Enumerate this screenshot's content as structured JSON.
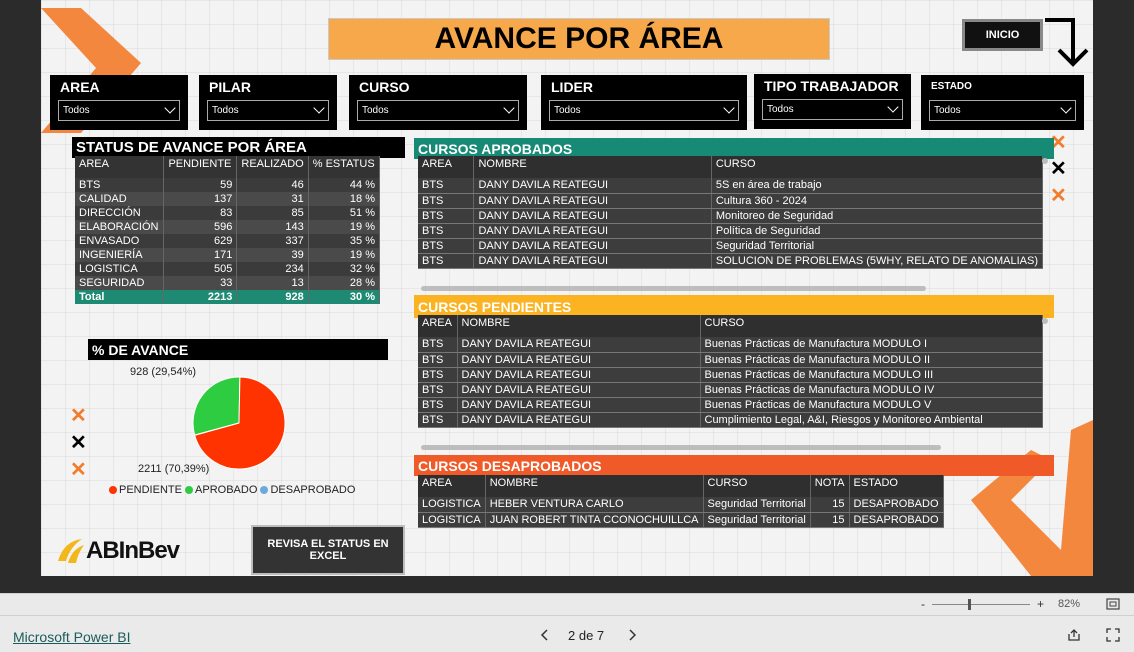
{
  "title": "AVANCE POR ÁREA",
  "inicio_button": "INICIO",
  "slicers": [
    {
      "label": "AREA",
      "value": "Todos"
    },
    {
      "label": "PILAR",
      "value": "Todos"
    },
    {
      "label": "CURSO",
      "value": "Todos"
    },
    {
      "label": "LIDER",
      "value": "Todos"
    },
    {
      "label": "TIPO TRABAJADOR",
      "value": "Todos"
    },
    {
      "label": "ESTADO",
      "value": "Todos"
    }
  ],
  "status": {
    "heading": "STATUS DE AVANCE POR ÁREA",
    "columns": [
      "AREA",
      "PENDIENTE",
      "REALIZADO",
      "% ESTATUS"
    ],
    "rows": [
      [
        "BTS",
        "59",
        "46",
        "44 %"
      ],
      [
        "CALIDAD",
        "137",
        "31",
        "18 %"
      ],
      [
        "DIRECCIÓN",
        "83",
        "85",
        "51 %"
      ],
      [
        "ELABORACIÓN",
        "596",
        "143",
        "19 %"
      ],
      [
        "ENVASADO",
        "629",
        "337",
        "35 %"
      ],
      [
        "INGENIERÍA",
        "171",
        "39",
        "19 %"
      ],
      [
        "LOGISTICA",
        "505",
        "234",
        "32 %"
      ],
      [
        "SEGURIDAD",
        "33",
        "13",
        "28 %"
      ]
    ],
    "total": [
      "Total",
      "2213",
      "928",
      "30 %"
    ]
  },
  "avance": {
    "heading": "% DE AVANCE",
    "label_aprobado": "928 (29,54%)",
    "label_pendiente": "2211 (70,39%)",
    "legend": [
      {
        "name": "PENDIENTE",
        "color": "#ff3300"
      },
      {
        "name": "APROBADO",
        "color": "#2ecc40"
      },
      {
        "name": "DESAPROBADO",
        "color": "#6fa8dc"
      }
    ]
  },
  "chart_data": {
    "type": "pie",
    "slices": [
      {
        "name": "PENDIENTE",
        "value": 2211,
        "percent": 70.39,
        "color": "#ff3300"
      },
      {
        "name": "APROBADO",
        "value": 928,
        "percent": 29.54,
        "color": "#2ecc40"
      },
      {
        "name": "DESAPROBADO",
        "value": 0,
        "percent": 0.07,
        "color": "#6fa8dc"
      }
    ]
  },
  "aprobados": {
    "heading": "CURSOS APROBADOS",
    "columns": [
      "AREA",
      "NOMBRE",
      "CURSO"
    ],
    "rows": [
      [
        "BTS",
        "DANY DAVILA REATEGUI",
        "5S en área de trabajo"
      ],
      [
        "BTS",
        "DANY DAVILA REATEGUI",
        "Cultura 360 - 2024"
      ],
      [
        "BTS",
        "DANY DAVILA REATEGUI",
        "Monitoreo de Seguridad"
      ],
      [
        "BTS",
        "DANY DAVILA REATEGUI",
        "Política de Seguridad"
      ],
      [
        "BTS",
        "DANY DAVILA REATEGUI",
        "Seguridad Territorial"
      ],
      [
        "BTS",
        "DANY DAVILA REATEGUI",
        "SOLUCION DE PROBLEMAS (5WHY, RELATO DE ANOMALIAS)"
      ]
    ]
  },
  "pendientes": {
    "heading": "CURSOS PENDIENTES",
    "columns": [
      "AREA",
      "NOMBRE",
      "CURSO"
    ],
    "rows": [
      [
        "BTS",
        "DANY DAVILA REATEGUI",
        "Buenas Prácticas de Manufactura MODULO I"
      ],
      [
        "BTS",
        "DANY DAVILA REATEGUI",
        "Buenas Prácticas de Manufactura MODULO II"
      ],
      [
        "BTS",
        "DANY DAVILA REATEGUI",
        "Buenas Prácticas de Manufactura MODULO III"
      ],
      [
        "BTS",
        "DANY DAVILA REATEGUI",
        "Buenas Prácticas de Manufactura MODULO IV"
      ],
      [
        "BTS",
        "DANY DAVILA REATEGUI",
        "Buenas Prácticas de Manufactura MODULO V"
      ],
      [
        "BTS",
        "DANY DAVILA REATEGUI",
        "Cumplimiento Legal, A&I, Riesgos y Monitoreo Ambiental"
      ]
    ]
  },
  "desaprobados": {
    "heading": "CURSOS DESAPROBADOS",
    "columns": [
      "AREA",
      "NOMBRE",
      "CURSO",
      "NOTA",
      "ESTADO"
    ],
    "rows": [
      [
        "LOGISTICA",
        "HEBER VENTURA CARLO",
        "Seguridad Territorial",
        "15",
        "DESAPROBADO"
      ],
      [
        "LOGISTICA",
        "JUAN ROBERT TINTA CCONOCHUILLCA",
        "Seguridad Territorial",
        "15",
        "DESAPROBADO"
      ]
    ]
  },
  "logo_text": "ABInBev",
  "excel_button": "REVISA EL STATUS EN EXCEL",
  "zoom": {
    "value": "82%",
    "minus": "-",
    "plus": "+"
  },
  "footer": {
    "brand": "Microsoft Power BI",
    "pagination": "2 de 7"
  },
  "colors": {
    "teal": "#168a75",
    "amber": "#fbb321",
    "orange_red": "#f05a28",
    "orange_accent": "#f47b2a"
  }
}
